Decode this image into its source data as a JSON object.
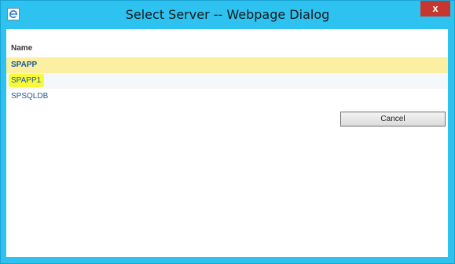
{
  "window": {
    "title": "Select Server -- Webpage Dialog",
    "close_label": "x",
    "app_icon": "internet-explorer-icon",
    "colors": {
      "frame": "#2dc2f0",
      "close": "#c7372f",
      "selected_row": "#fcefa1",
      "link": "#1c5a96"
    }
  },
  "list": {
    "header": "Name",
    "items": [
      {
        "label": "SPAPP",
        "state": "selected"
      },
      {
        "label": "SPAPP1",
        "state": "highlighted"
      },
      {
        "label": "SPSQLDB",
        "state": "normal"
      }
    ]
  },
  "buttons": {
    "cancel": "Cancel"
  }
}
